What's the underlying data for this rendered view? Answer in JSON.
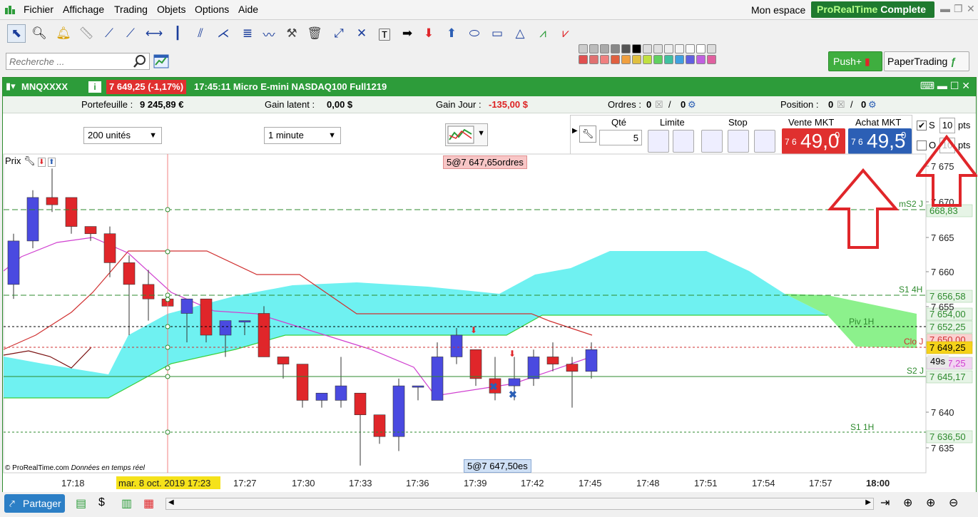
{
  "menu": {
    "items": [
      "Fichier",
      "Affichage",
      "Trading",
      "Objets",
      "Options",
      "Aide"
    ],
    "workspace": "Mon espace",
    "brand": "ProRealTime",
    "edition": "Complete"
  },
  "search": {
    "placeholder": "Recherche ..."
  },
  "buttons": {
    "push": "Push+",
    "papertrading": "PaperTrading"
  },
  "window": {
    "symbol": "MNQXXXX",
    "info_icon": "i",
    "price_change": "7 649,25 (-1,17%)",
    "time_desc": "17:45:11 Micro E-mini NASDAQ100 Full1219"
  },
  "account": {
    "portefeuille_label": "Portefeuille :",
    "portefeuille_value": "9 245,89 €",
    "gain_latent_label": "Gain latent :",
    "gain_latent_value": "0,00 $",
    "gain_jour_label": "Gain Jour :",
    "gain_jour_value": "-135,00 $",
    "ordres_label": "Ordres :",
    "ordres_value": "0",
    "ordres_value2": "0",
    "position_label": "Position :",
    "position_value": "0",
    "position_value2": "0"
  },
  "settings": {
    "units": "200 unités",
    "interval": "1 minute"
  },
  "ticket": {
    "qty_label": "Qté",
    "qty_value": "5",
    "limit_label": "Limite",
    "stop_label": "Stop",
    "sell_label": "Vente MKT",
    "buy_label": "Achat MKT",
    "sell_small": "7 6",
    "sell_big": "49,0",
    "buy_small": "7 6",
    "buy_big": "49,5",
    "sup": "0",
    "s_label": "S",
    "o_label": "O",
    "s_pts": "10",
    "o_pts": "10",
    "pts": "pts"
  },
  "chart_panel": {
    "prix_label": "Prix",
    "order_tag_top": "5@7 647,65",
    "ordres_text": "ordres",
    "order_tag_bottom": "5@7 647,50",
    "order_tag_bottom_suffix": "es",
    "copyright": "© ProRealTime.com",
    "realtime": "Données en temps réel",
    "countdown": "49s"
  },
  "chart_data": {
    "type": "candlestick",
    "x_tick_labels": [
      "17:18",
      "mar. 8 oct. 2019 17:23",
      "17:27",
      "17:30",
      "17:33",
      "17:36",
      "17:39",
      "17:42",
      "17:45",
      "17:48",
      "17:51",
      "17:54",
      "17:57",
      "18:00"
    ],
    "y_tick_labels": [
      "7 675",
      "7 670",
      "7 665",
      "7 660",
      "7 655",
      "7 640",
      "7 635"
    ],
    "ylim": [
      7633,
      7677
    ],
    "candles": [
      {
        "o": 7659,
        "h": 7666,
        "l": 7657,
        "c": 7665
      },
      {
        "o": 7665,
        "h": 7672,
        "l": 7664,
        "c": 7671
      },
      {
        "o": 7671,
        "h": 7675,
        "l": 7669,
        "c": 7670
      },
      {
        "o": 7671,
        "h": 7671,
        "l": 7666,
        "c": 7667
      },
      {
        "o": 7667,
        "h": 7667,
        "l": 7665,
        "c": 7666
      },
      {
        "o": 7666,
        "h": 7667,
        "l": 7660,
        "c": 7662
      },
      {
        "o": 7662,
        "h": 7663,
        "l": 7652,
        "c": 7659
      },
      {
        "o": 7659,
        "h": 7661,
        "l": 7654,
        "c": 7657
      },
      {
        "o": 7657,
        "h": 7658,
        "l": 7652,
        "c": 7656
      },
      {
        "o": 7655,
        "h": 7657,
        "l": 7651,
        "c": 7657
      },
      {
        "o": 7657,
        "h": 7657,
        "l": 7651,
        "c": 7652
      },
      {
        "o": 7652,
        "h": 7653,
        "l": 7649,
        "c": 7654
      },
      {
        "o": 7654,
        "h": 7654,
        "l": 7652,
        "c": 7654
      },
      {
        "o": 7655,
        "h": 7656,
        "l": 7649,
        "c": 7649
      },
      {
        "o": 7649,
        "h": 7649,
        "l": 7646,
        "c": 7648
      },
      {
        "o": 7648,
        "h": 7648,
        "l": 7642,
        "c": 7643
      },
      {
        "o": 7643,
        "h": 7643,
        "l": 7642,
        "c": 7644
      },
      {
        "o": 7643,
        "h": 7649,
        "l": 7642,
        "c": 7645
      },
      {
        "o": 7644,
        "h": 7644,
        "l": 7634,
        "c": 7641
      },
      {
        "o": 7641,
        "h": 7641,
        "l": 7637,
        "c": 7638
      },
      {
        "o": 7638,
        "h": 7646,
        "l": 7636,
        "c": 7645
      },
      {
        "o": 7645,
        "h": 7645,
        "l": 7643,
        "c": 7645
      },
      {
        "o": 7643,
        "h": 7651,
        "l": 7643,
        "c": 7649
      },
      {
        "o": 7649,
        "h": 7653,
        "l": 7648,
        "c": 7652
      },
      {
        "o": 7650,
        "h": 7650,
        "l": 7645,
        "c": 7646
      },
      {
        "o": 7646,
        "h": 7649,
        "l": 7643,
        "c": 7644
      },
      {
        "o": 7645,
        "h": 7649,
        "l": 7643,
        "c": 7646
      },
      {
        "o": 7646,
        "h": 7650,
        "l": 7645,
        "c": 7649
      },
      {
        "o": 7649,
        "h": 7651,
        "l": 7647,
        "c": 7648
      },
      {
        "o": 7648,
        "h": 7649,
        "l": 7642,
        "c": 7647
      },
      {
        "o": 7647,
        "h": 7651,
        "l": 7646,
        "c": 7650
      }
    ],
    "levels": [
      {
        "name": "mS2 J",
        "tag": "668,83"
      },
      {
        "name": "S1 4H",
        "tag": "7 656,58"
      },
      {
        "name": "",
        "tag": "7 654,00"
      },
      {
        "name": "Piv 1H",
        "tag": ""
      },
      {
        "name": "",
        "tag": "7 652,25"
      },
      {
        "name": "Clo J",
        "tag": "7 650,00"
      },
      {
        "name": "",
        "tag": "7 649,25"
      },
      {
        "name": "",
        "tag": "7 647,25"
      },
      {
        "name": "S2 J",
        "tag": "7 645,17"
      },
      {
        "name": "S1 1H",
        "tag": "7 636,50"
      }
    ]
  },
  "bottom": {
    "share": "Partager"
  },
  "colors": {
    "up": "#4a4ae0",
    "down": "#e0262a",
    "cloud": "#5ff0f0",
    "green_cloud": "#7ff07f",
    "accent": "#2d9c3a"
  }
}
